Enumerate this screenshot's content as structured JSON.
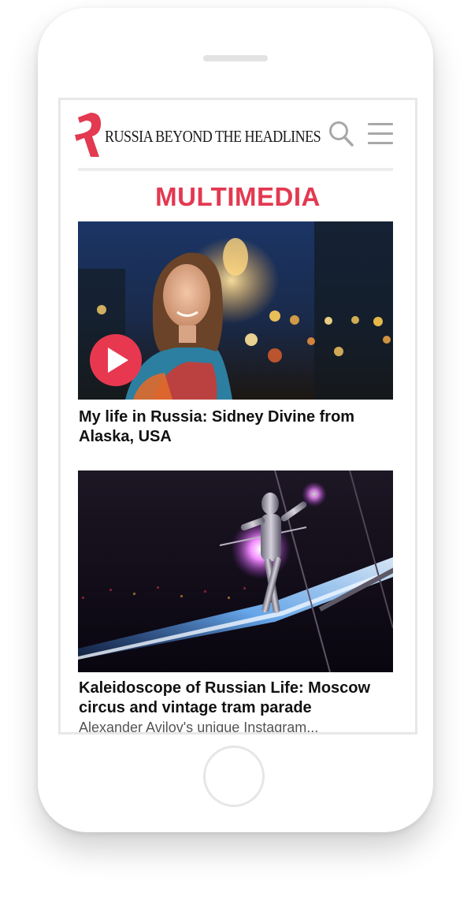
{
  "header": {
    "logo_text": "RUSSIA BEYOND THE HEADLINES"
  },
  "section": {
    "title": "MULTIMEDIA"
  },
  "articles": [
    {
      "title": "My life in Russia: Sidney Divine from Alaska, USA",
      "media_type": "video"
    },
    {
      "title": "Kaleidoscope of Russian Life: Moscow circus and vintage tram parade",
      "excerpt": "Alexander Avilov's unique Instagram..."
    }
  ],
  "colors": {
    "brand": "#e33951",
    "play_button": "#e8384f"
  },
  "icons": {
    "search": "search-icon",
    "menu": "menu-icon",
    "logo": "logo-icon",
    "play": "play-icon"
  }
}
